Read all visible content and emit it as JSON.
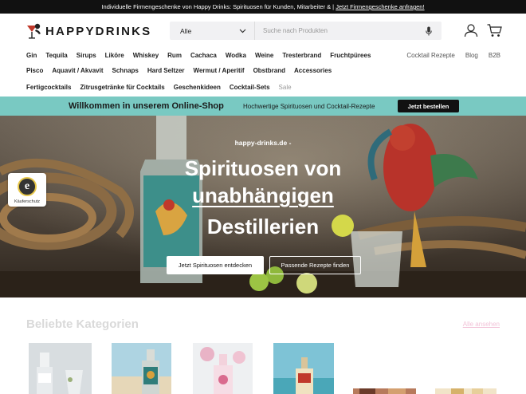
{
  "topbar": {
    "text": "Individuelle Firmengeschenke von Happy Drinks: Spirituosen für Kunden, Mitarbeiter & |",
    "link": "Jetzt Firmengeschenke anfragen!"
  },
  "header": {
    "logo_text": "HAPPYDRINKS",
    "search": {
      "category": "Alle",
      "placeholder": "Suche nach Produkten"
    }
  },
  "nav": {
    "row1": [
      "Gin",
      "Tequila",
      "Sirups",
      "Liköre",
      "Whiskey",
      "Rum",
      "Cachaca",
      "Wodka",
      "Weine",
      "Tresterbrand",
      "Fruchtpürees"
    ],
    "row2": [
      "Pisco",
      "Aquavit / Akvavit",
      "Schnaps",
      "Hard Seltzer",
      "Wermut / Aperitif",
      "Obstbrand",
      "Accessories"
    ],
    "row3": [
      "Fertigcocktails",
      "Zitrusgetränke für Cocktails",
      "Geschenkideen",
      "Cocktail-Sets",
      "Sale"
    ],
    "right": [
      "Cocktail Rezepte",
      "Blog",
      "B2B"
    ]
  },
  "welcome": {
    "title": "Willkommen in unserem Online-Shop",
    "text": "Hochwertige Spirituosen und Cocktail-Rezepte",
    "button": "Jetzt bestellen"
  },
  "hero": {
    "kicker": "happy-drinks.de -",
    "line1": "Spirituosen von",
    "line2": "unabhängigen",
    "line3": "Destillerien",
    "btn_primary": "Jetzt Spirituosen entdecken",
    "btn_secondary": "Passende Rezepte finden"
  },
  "trust_badge": {
    "label": "Käuferschutz"
  },
  "categories": {
    "title": "Beliebte Kategorien",
    "link": "Alle ansehen"
  },
  "colors": {
    "accent_teal": "#79c9c2",
    "topbar": "#111111"
  }
}
